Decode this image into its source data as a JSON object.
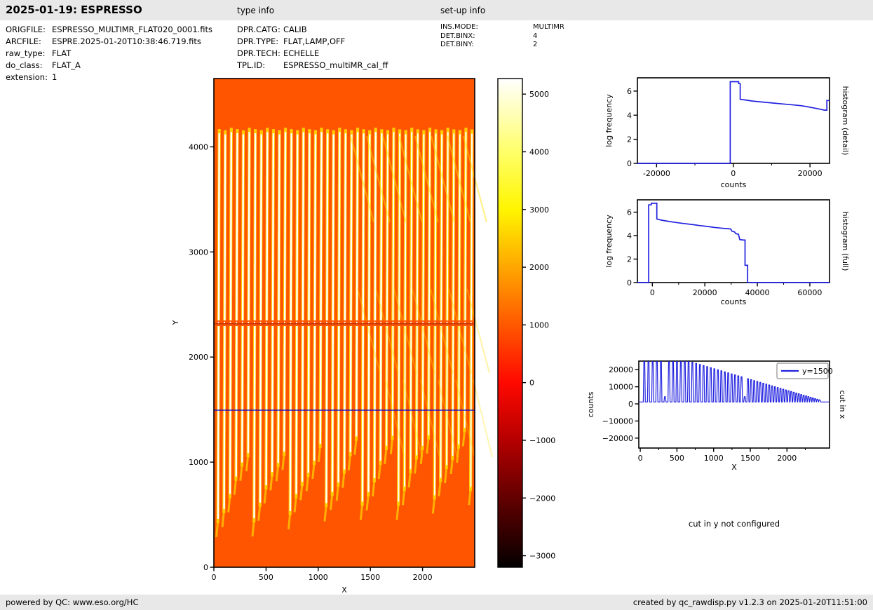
{
  "header": {
    "title": "2025-01-19: ESPRESSO",
    "type_info_label": "type info",
    "setup_info_label": "set-up info"
  },
  "file_info": {
    "rows": [
      {
        "label": "ORIGFILE:",
        "value": "ESPRESSO_MULTIMR_FLAT020_0001.fits"
      },
      {
        "label": "ARCFILE:",
        "value": "ESPRE.2025-01-20T10:38:46.719.fits"
      },
      {
        "label": "raw_type:",
        "value": "FLAT"
      },
      {
        "label": "do_class:",
        "value": "FLAT_A"
      },
      {
        "label": "extension:",
        "value": "1"
      }
    ]
  },
  "type_info": {
    "rows": [
      {
        "label": "DPR.CATG:",
        "value": "CALIB"
      },
      {
        "label": "DPR.TYPE:",
        "value": "FLAT,LAMP,OFF"
      },
      {
        "label": "DPR.TECH:",
        "value": "ECHELLE"
      },
      {
        "label": "TPL.ID:",
        "value": "ESPRESSO_multiMR_cal_ff"
      }
    ]
  },
  "setup_info": {
    "rows": [
      {
        "label": "INS.MODE:",
        "value": "MULTIMR"
      },
      {
        "label": "DET.BINX:",
        "value": "4"
      },
      {
        "label": "DET.BINY:",
        "value": "2"
      }
    ]
  },
  "note": "cut in y not configured",
  "footer": {
    "left": "powered by QC: www.eso.org/HC",
    "right": "created by qc_rawdisp.py v1.2.3 on 2025-01-20T11:51:00"
  },
  "colors": {
    "curve_blue": "#2222e0",
    "heat_background": "#ff5400",
    "stripe_white": "#ffffff",
    "stripe_edge_yellow": "#ffd200",
    "gap_line": "#c33500",
    "cut_line_blue": "#0000dd",
    "band_gray": "#e8e8e8"
  },
  "chart_data": [
    {
      "id": "main_image",
      "type": "heatmap",
      "title": "",
      "xlabel": "X",
      "ylabel": "Y",
      "xlim": [
        0,
        2500
      ],
      "ylim": [
        0,
        4650
      ],
      "xticks": [
        0,
        500,
        1000,
        1500,
        2000
      ],
      "yticks": [
        0,
        1000,
        2000,
        3000,
        4000
      ],
      "description": "raw echelle flat frame: orange background with ~43 bright tilted vertical order stripes between y=500 and y=4130, detector gap line at y=2330, blue cut line at y=1500",
      "n_order_stripes": 43,
      "order_top_y": 4130,
      "order_bottom_y_range": [
        500,
        1000
      ],
      "detector_gap_y": 2330,
      "cut_line": {
        "y": 1500
      },
      "colorbar": {
        "colormap": "hot",
        "vmin": -3200,
        "vmax": 5270,
        "ticks": [
          5000,
          4000,
          3000,
          2000,
          1000,
          0,
          -1000,
          -2000,
          -3000
        ],
        "tick_labels": [
          "5000",
          "4000",
          "3000",
          "2000",
          "1000",
          "0",
          "−1000",
          "−2000",
          "−3000"
        ]
      }
    },
    {
      "id": "hist_detail",
      "type": "line",
      "xlabel": "counts",
      "ylabel": "log frequency",
      "right_label": "histogram (detail)",
      "xlim": [
        -25000,
        25100
      ],
      "ylim": [
        0,
        7.1
      ],
      "xticks": [
        -20000,
        0,
        20000
      ],
      "xtick_labels": [
        "-20000",
        "0",
        "20000"
      ],
      "xminor": [
        -10000,
        10000
      ],
      "yticks": [
        0,
        2,
        4,
        6
      ],
      "points": [
        [
          -25000,
          0
        ],
        [
          -800,
          0
        ],
        [
          -800,
          6.78
        ],
        [
          1400,
          6.78
        ],
        [
          1400,
          6.62
        ],
        [
          1800,
          6.62
        ],
        [
          1800,
          5.32
        ],
        [
          3200,
          5.26
        ],
        [
          4800,
          5.18
        ],
        [
          6500,
          5.12
        ],
        [
          8300,
          5.07
        ],
        [
          10200,
          5.01
        ],
        [
          12000,
          4.96
        ],
        [
          14000,
          4.9
        ],
        [
          15800,
          4.85
        ],
        [
          17600,
          4.79
        ],
        [
          19000,
          4.72
        ],
        [
          20500,
          4.63
        ],
        [
          21800,
          4.55
        ],
        [
          23000,
          4.47
        ],
        [
          23800,
          4.42
        ],
        [
          24400,
          4.42
        ],
        [
          24400,
          5.22
        ],
        [
          25100,
          5.22
        ]
      ]
    },
    {
      "id": "hist_full",
      "type": "line",
      "xlabel": "counts",
      "ylabel": "log frequency",
      "right_label": "histogram (full)",
      "xlim": [
        -5700,
        67500
      ],
      "ylim": [
        0,
        7.05
      ],
      "xticks": [
        0,
        20000,
        40000,
        60000
      ],
      "xtick_labels": [
        "0",
        "20000",
        "40000",
        "60000"
      ],
      "xminor": [
        10000,
        30000,
        50000
      ],
      "yticks": [
        0,
        2,
        4,
        6
      ],
      "points": [
        [
          -5700,
          0
        ],
        [
          -1400,
          0
        ],
        [
          -1400,
          6.62
        ],
        [
          -400,
          6.62
        ],
        [
          -400,
          6.76
        ],
        [
          1700,
          6.76
        ],
        [
          1700,
          5.42
        ],
        [
          3500,
          5.32
        ],
        [
          6000,
          5.22
        ],
        [
          9000,
          5.12
        ],
        [
          12000,
          5.03
        ],
        [
          15000,
          4.95
        ],
        [
          18000,
          4.86
        ],
        [
          21000,
          4.78
        ],
        [
          23500,
          4.7
        ],
        [
          26000,
          4.64
        ],
        [
          28000,
          4.6
        ],
        [
          29800,
          4.57
        ],
        [
          30300,
          4.38
        ],
        [
          31300,
          4.32
        ],
        [
          31800,
          4.17
        ],
        [
          32800,
          4.12
        ],
        [
          33300,
          3.66
        ],
        [
          34800,
          3.62
        ],
        [
          35300,
          3.62
        ],
        [
          35300,
          1.47
        ],
        [
          36300,
          1.47
        ],
        [
          36300,
          0
        ],
        [
          67500,
          0
        ]
      ]
    },
    {
      "id": "cut_x",
      "type": "line",
      "xlabel": "X",
      "ylabel": "counts",
      "right_label": "cut in x",
      "legend_label": "y=1500",
      "xlim": [
        -20,
        2580
      ],
      "ylim": [
        -25800,
        25000
      ],
      "xticks": [
        0,
        500,
        1000,
        1500,
        2000
      ],
      "xtick_labels": [
        "0",
        "500",
        "1000",
        "1500",
        "2000"
      ],
      "xminor": [
        250,
        750,
        1250,
        1750,
        2250
      ],
      "yticks": [
        20000,
        10000,
        0,
        -10000,
        -20000
      ],
      "ytick_labels": [
        "20000",
        "10000",
        "0",
        "−10000",
        "−20000"
      ],
      "spikes": {
        "baseline": 1100,
        "first_center": 55,
        "first_gap": 58,
        "gap_shrink": 0.52,
        "last_x": 2460,
        "peak_max": 24700,
        "envelope_flat_until": 680,
        "envelope_slope": 12.7,
        "envelope_min": 2100,
        "low_spike_indices": [
          5,
          27
        ],
        "low_spike_value": 4200
      }
    }
  ]
}
